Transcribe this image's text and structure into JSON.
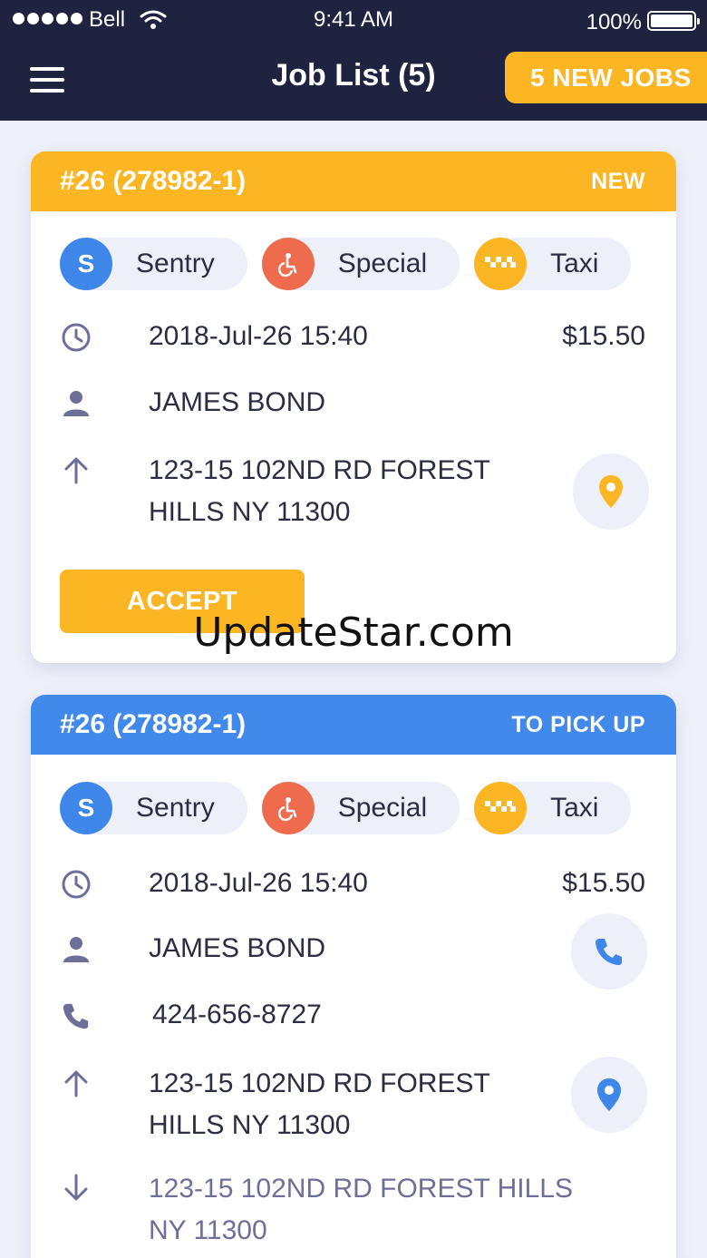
{
  "status_bar": {
    "carrier": "Bell",
    "time": "9:41 AM",
    "battery": "100%"
  },
  "header": {
    "title": "Job List (5)",
    "new_jobs_label": "5 NEW JOBS"
  },
  "cards": [
    {
      "job_id": "#26 (278982-1)",
      "status": "NEW",
      "chips": [
        {
          "badge": "S",
          "label": "Sentry"
        },
        {
          "label": "Special"
        },
        {
          "label": "Taxi"
        }
      ],
      "datetime": "2018-Jul-26  15:40",
      "price": "$15.50",
      "customer": "JAMES BOND",
      "pickup_line1": "123-15 102ND RD FOREST",
      "pickup_line2": "HILLS NY 11300",
      "accept_label": "ACCEPT"
    },
    {
      "job_id": "#26 (278982-1)",
      "status": "TO PICK UP",
      "chips": [
        {
          "badge": "S",
          "label": "Sentry"
        },
        {
          "label": "Special"
        },
        {
          "label": "Taxi"
        }
      ],
      "datetime": "2018-Jul-26  15:40",
      "price": "$15.50",
      "customer": "JAMES BOND",
      "phone": "424-656-8727",
      "pickup_line1": "123-15 102ND RD FOREST",
      "pickup_line2": "HILLS NY 11300",
      "dropoff_line1": "123-15 102ND RD FOREST HILLS",
      "dropoff_line2": "NY 11300"
    }
  ],
  "watermark": "UpdateStar.com",
  "colors": {
    "navy": "#1f2340",
    "yellow": "#fdb623",
    "blue": "#4289ec",
    "chip_bg": "#eef0f9",
    "red": "#ee6b4d"
  }
}
